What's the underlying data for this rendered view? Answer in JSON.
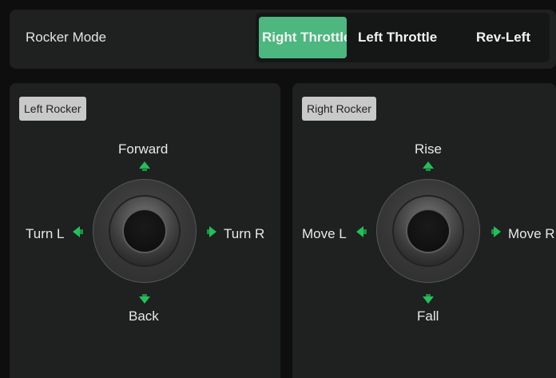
{
  "top_bar": {
    "title": "Rocker Mode",
    "options": [
      "Right Throttle",
      "Left Throttle",
      "Rev-Left"
    ],
    "selected_index": 0
  },
  "left_panel": {
    "tag": "Left Rocker",
    "up": "Forward",
    "down": "Back",
    "left": "Turn L",
    "right": "Turn R"
  },
  "right_panel": {
    "tag": "Right Rocker",
    "up": "Rise",
    "down": "Fall",
    "left": "Move L",
    "right": "Move R"
  },
  "colors": {
    "accent": "#4cb77f",
    "arrow": "#22c05a",
    "panel": "#1f2020",
    "background": "#0e0e0e"
  }
}
